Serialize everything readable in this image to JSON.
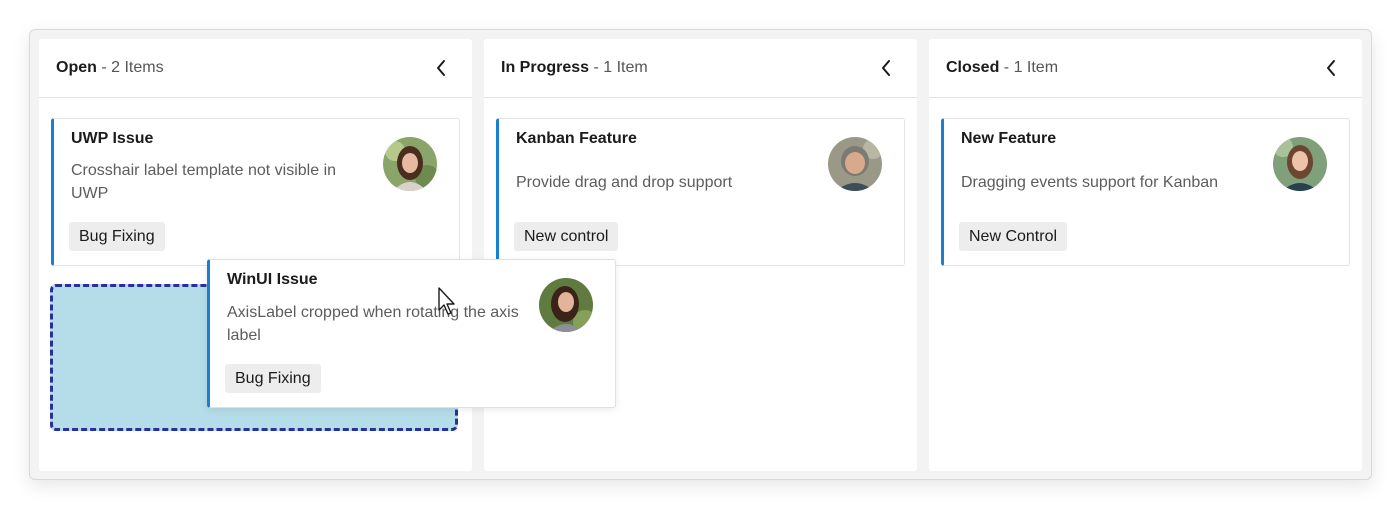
{
  "columns": [
    {
      "name": "Open",
      "count": " - 2 Items"
    },
    {
      "name": "In Progress",
      "count": " - 1 Item"
    },
    {
      "name": "Closed",
      "count": " - 1 Item"
    }
  ],
  "cards": {
    "uwp": {
      "title": "UWP Issue",
      "description": "Crosshair label template not visible in UWP",
      "tag": "Bug Fixing"
    },
    "kanban": {
      "title": "Kanban Feature",
      "description": "Provide drag and drop support",
      "tag": "New control"
    },
    "newfeature": {
      "title": "New Feature",
      "description": "Dragging events support for Kanban",
      "tag": "New Control"
    },
    "winui": {
      "title": "WinUI Issue",
      "description": "AxisLabel cropped when rotating the axis label",
      "tag": "Bug Fixing"
    }
  },
  "icons": {
    "collapse": "chevron-left-icon",
    "avatar": "avatar-photo",
    "cursor": "mouse-pointer-icon"
  },
  "colors": {
    "card_accent": "#1a7fd1",
    "drop_fill": "#b5dce9",
    "drop_border": "#2b2f9e",
    "tag_bg": "#ededed"
  }
}
